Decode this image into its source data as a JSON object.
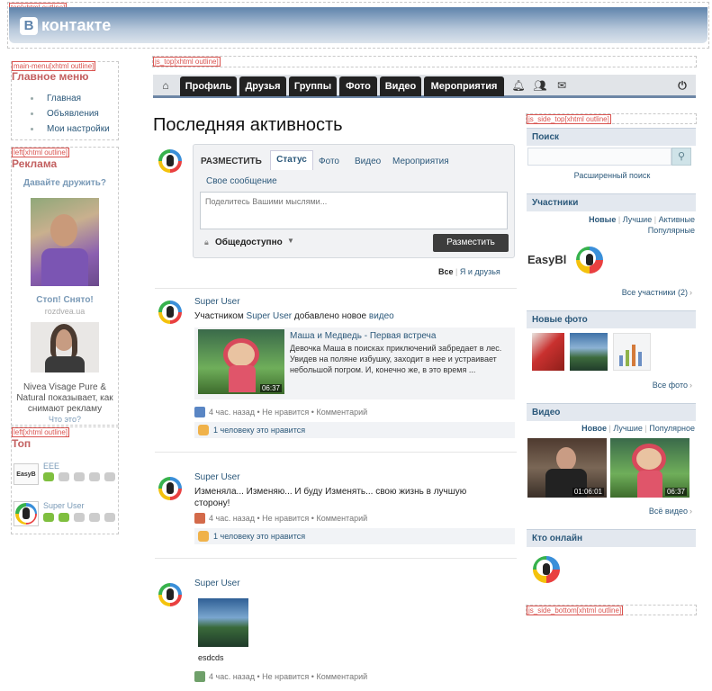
{
  "outline_labels": {
    "top": "top[xhtml outline]",
    "main_menu": "main-menu[xhtml outline]",
    "left1": "left[xhtml outline]",
    "left2": "left[xhtml outline]",
    "js_top": "js_top[xhtml outline]",
    "js_side_top": "js_side_top[xhtml outline]",
    "js_side_bottom": "js_side_bottom[xhtml outline]"
  },
  "header": {
    "logo_letter": "B",
    "logo_text": "контакте",
    "gradient_top": "#5e83ab"
  },
  "main_menu": {
    "title": "Главное меню",
    "items": [
      "Главная",
      "Объявления",
      "Мои настройки"
    ]
  },
  "ads": {
    "title": "Реклама",
    "make_friends": "Давайте дружить?",
    "ad1_title": "Стоп! Снято!",
    "ad1_site": "rozdvea.ua",
    "ad2_text": "Nivea Visage Pure & Natural показывает, как снимают рекламу",
    "ad2_link": "Что это?"
  },
  "top_block": {
    "title": "Топ",
    "items": [
      {
        "name": "EEE",
        "logo_text": "EasyB"
      },
      {
        "name": "Super User",
        "logo_text": ""
      }
    ]
  },
  "nav": {
    "home_icon": "home-icon",
    "buttons": [
      "Профиль",
      "Друзья",
      "Группы",
      "Фото",
      "Видео",
      "Мероприятия"
    ],
    "right_icons": [
      "bell-icon",
      "users-icon",
      "inbox-icon"
    ],
    "power_icon": "power-icon"
  },
  "page_title": "Последняя активность",
  "post_box": {
    "label": "РАЗМЕСТИТЬ",
    "tabs": [
      "Статус",
      "Фото",
      "Видео",
      "Мероприятия"
    ],
    "own_message": "Свое сообщение",
    "placeholder": "Поделитесь Вашими мыслями...",
    "privacy": "Общедоступно",
    "publish": "Разместить"
  },
  "filter": {
    "all": "Все",
    "me_and_friends": "Я и друзья"
  },
  "feed": [
    {
      "user": "Super User",
      "action_prefix": "Участником",
      "action_user": "Super User",
      "action_suffix": "добавлено новое",
      "action_object": "видео",
      "video_title": "Маша и Медведь - Первая встреча",
      "video_desc": "Девочка Маша в поисках приключений забредает в лес. Увидев на поляне избушку, заходит в нее и устраивает небольшой погром. И, конечно же, в это время ...",
      "video_duration": "06:37",
      "meta": "4 час. назад • Не нравится • Комментарий",
      "likes": "1 человеку это нравится"
    },
    {
      "user": "Super User",
      "text": "Изменяла... Изменяю... И буду Изменять... свою жизнь в лучшую сторону!",
      "meta": "4 час. назад • Не нравится • Комментарий",
      "likes": "1 человеку это нравится"
    },
    {
      "user": "Super User",
      "photo_caption": "esdcds",
      "meta": "4 час. назад • Не нравится • Комментарий"
    }
  ],
  "sidebar": {
    "search": {
      "title": "Поиск",
      "advanced": "Расширенный поиск"
    },
    "members": {
      "title": "Участники",
      "filters": [
        "Новые",
        "Лучшие",
        "Активные",
        "Популярные"
      ],
      "member_logo_text": "EasyBl",
      "all_link": "Все участники (2)"
    },
    "photos": {
      "title": "Новые фото",
      "all_link": "Все фото"
    },
    "videos": {
      "title": "Видео",
      "filters": [
        "Новое",
        "Лучшие",
        "Популярное"
      ],
      "durations": [
        "01:06:01",
        "06:37"
      ],
      "all_link": "Всё видео"
    },
    "online": {
      "title": "Кто онлайн"
    }
  },
  "colors": {
    "link": "#2b587a",
    "accent_red": "#c36060",
    "nav_dark": "#222222"
  }
}
